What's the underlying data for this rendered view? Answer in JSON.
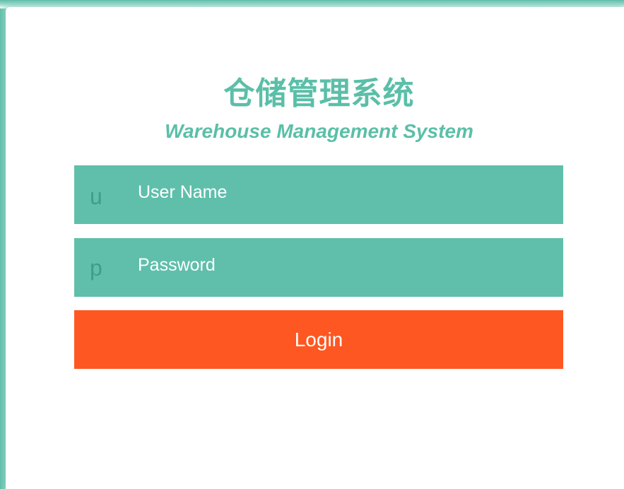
{
  "header": {
    "title_cn": "仓储管理系统",
    "title_en": "Warehouse Management System"
  },
  "form": {
    "username": {
      "icon_letter": "u",
      "icon_name": "user-icon",
      "placeholder": "User Name",
      "value": ""
    },
    "password": {
      "icon_letter": "p",
      "icon_name": "password-icon",
      "placeholder": "Password",
      "value": ""
    },
    "login_label": "Login"
  },
  "colors": {
    "accent": "#5fbfab",
    "title": "#5bbfa8",
    "icon": "#3f9e86",
    "button": "#ff5722"
  }
}
